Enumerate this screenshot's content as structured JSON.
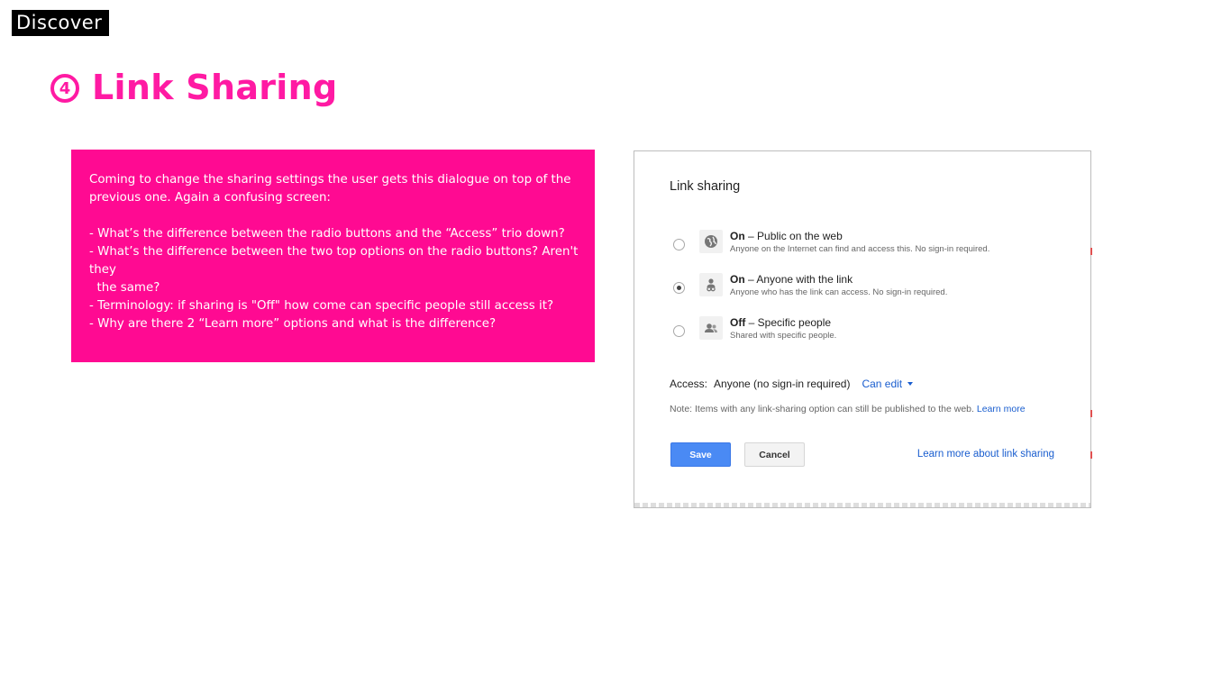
{
  "header": {
    "tag": "Discover",
    "step_number": "4",
    "title": "Link Sharing"
  },
  "note": {
    "intro": "Coming to change the sharing settings the user gets this dialogue on top of the previous one. Again a confusing screen:",
    "points": [
      "- What’s the difference between the radio buttons and the “Access” trio down?",
      "- What’s the difference between the two top options on the radio buttons? Aren't they",
      "  the same?",
      "- Terminology: if sharing is \"Off\" how come can specific people still access it?",
      "- Why are there 2 “Learn more” options and what is the difference?"
    ]
  },
  "dialog": {
    "title": "Link sharing",
    "options": [
      {
        "bold": "On",
        "label": " – Public on the web",
        "desc": "Anyone on the Internet can find and access this. No sign-in required.",
        "icon": "globe-icon",
        "selected": false
      },
      {
        "bold": "On",
        "label": " – Anyone with the link",
        "desc": "Anyone who has the link can access. No sign-in required.",
        "icon": "link-person-icon",
        "selected": true
      },
      {
        "bold": "Off",
        "label": " – Specific people",
        "desc": "Shared with specific people.",
        "icon": "people-icon",
        "selected": false
      }
    ],
    "access_label": "Access:",
    "access_value": "Anyone (no sign-in required)",
    "permission": "Can edit",
    "note_text": "Note: Items with any link-sharing option can still be published to the web. ",
    "note_link": "Learn more",
    "save": "Save",
    "cancel": "Cancel",
    "learn_more": "Learn more about link sharing"
  },
  "colors": {
    "accent": "#ff0a92",
    "link": "#1a5ecf",
    "save": "#4a8af4"
  }
}
